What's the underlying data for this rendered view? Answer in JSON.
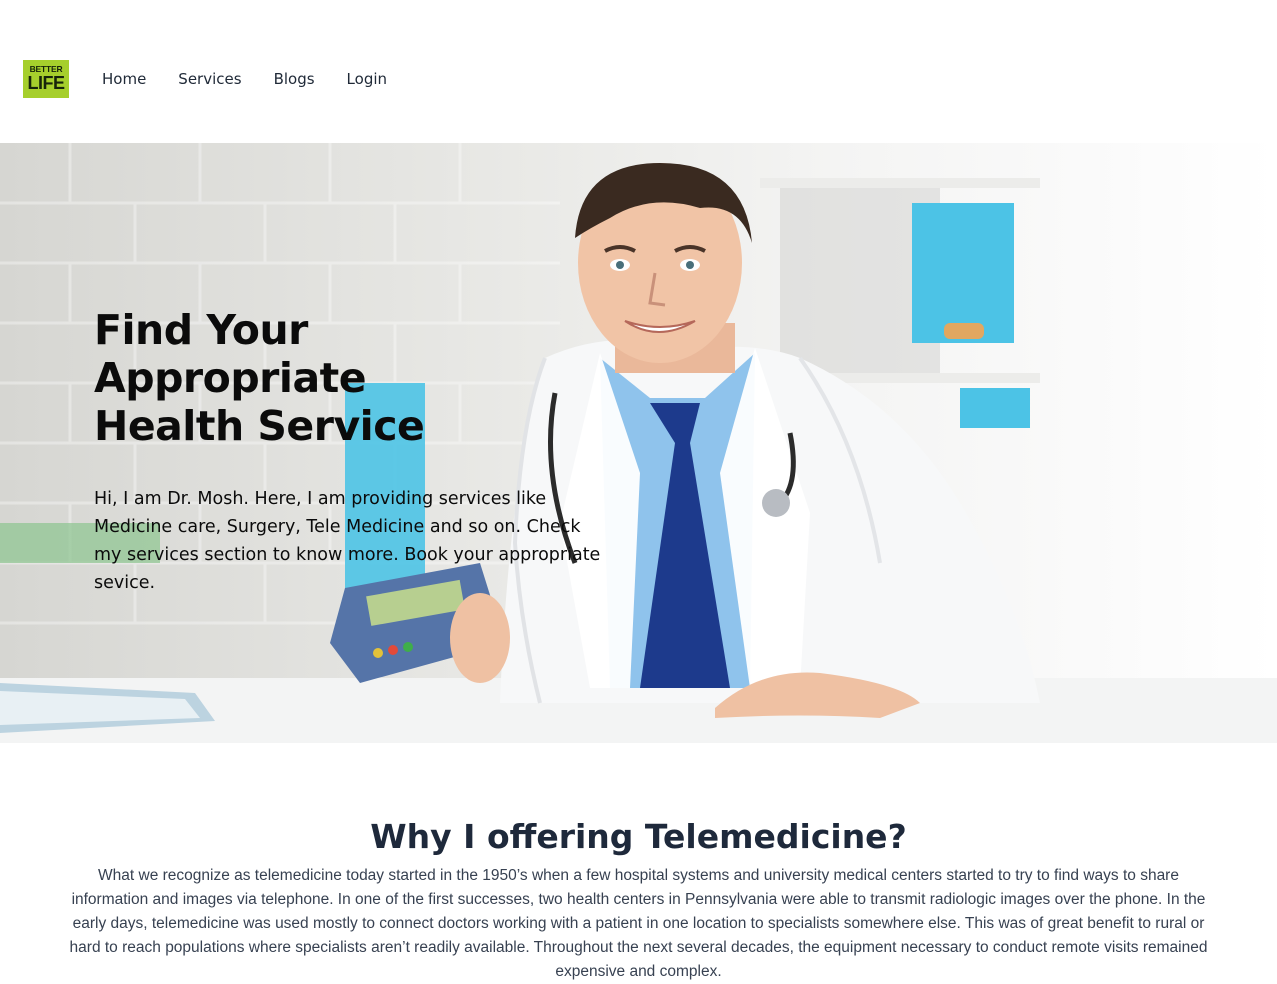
{
  "header": {
    "logo": {
      "line1": "BETTER",
      "line2": "LIFE"
    },
    "nav": [
      {
        "label": "Home"
      },
      {
        "label": "Services"
      },
      {
        "label": "Blogs"
      },
      {
        "label": "Login"
      }
    ]
  },
  "hero": {
    "title": "Find Your Appropriate Health Service",
    "description": "Hi, I am Dr. Mosh. Here, I am providing services like Medicine care, Surgery, Tele Medicine and so on. Check my services section to know more. Book your appropriate sevice."
  },
  "telemedicine": {
    "heading": "Why I offering Telemedicine?",
    "body": "What we recognize as telemedicine today started in the 1950’s when a few hospital systems and university medical centers started to try to find ways to share information and images via telephone. In one of the first successes, two health centers in Pennsylvania were able to transmit radiologic images over the phone. In the early days, telemedicine was used mostly to connect doctors working with a patient in one location to specialists somewhere else. This was of great benefit to rural or hard to reach populations where specialists aren’t readily available. Throughout the next several decades, the equipment necessary to conduct remote visits remained expensive and complex."
  },
  "colors": {
    "logo_bg": "#a6cf2c",
    "nav_text": "#1f2937",
    "heading": "#1e293b",
    "body_text": "#374151"
  }
}
